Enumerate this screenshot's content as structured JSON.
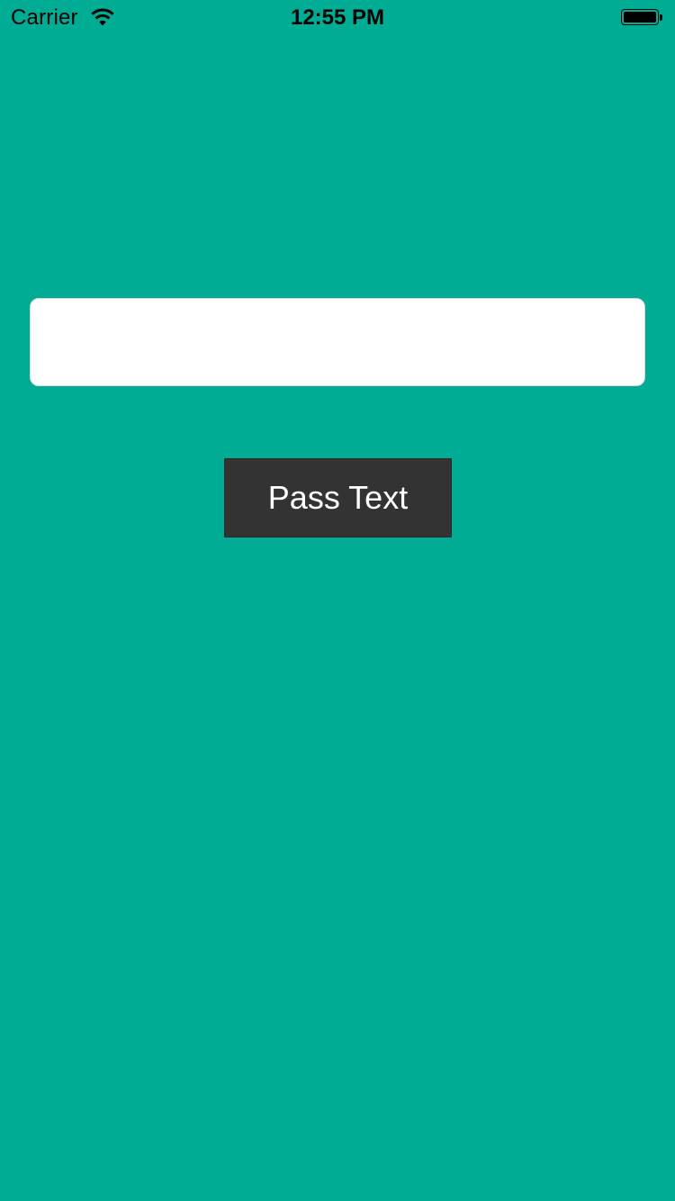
{
  "status_bar": {
    "carrier": "Carrier",
    "time": "12:55 PM",
    "wifi_icon": "wifi-icon",
    "battery_icon": "battery-icon",
    "battery_level": 1.0
  },
  "main": {
    "text_field": {
      "value": "",
      "placeholder": ""
    },
    "pass_button_label": "Pass Text"
  },
  "colors": {
    "background": "#00ac93",
    "button_background": "#333333",
    "button_text": "#ffffff",
    "text_field_background": "#ffffff"
  }
}
